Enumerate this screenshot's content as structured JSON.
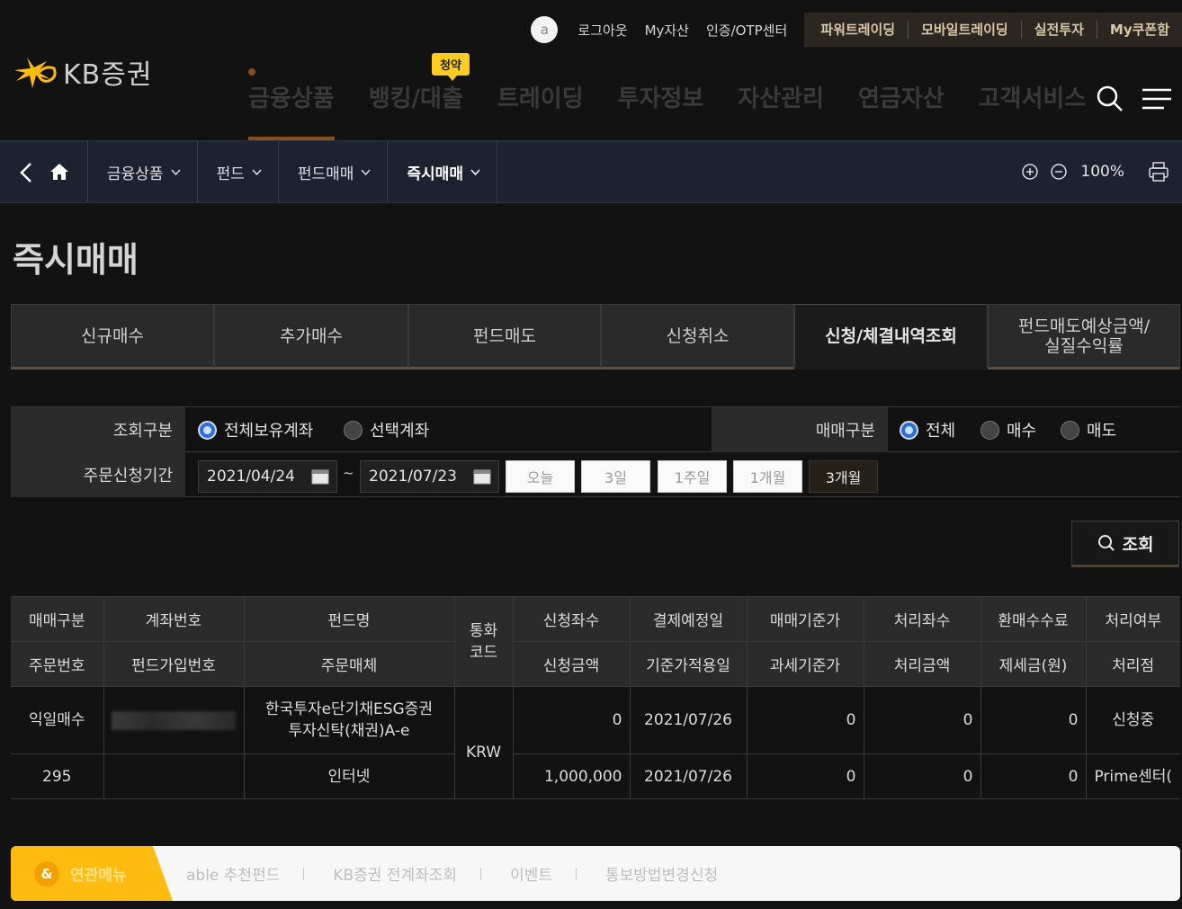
{
  "header": {
    "avatar_letter": "a",
    "util_links": [
      "로그아웃",
      "My자산",
      "인증/OTP센터"
    ],
    "util_box": [
      "파워트레이딩",
      "모바일트레이딩",
      "실전투자",
      "My쿠폰함"
    ],
    "logo_text": "KB증권",
    "gnb": [
      "금융상품",
      "뱅킹/대출",
      "트레이딩",
      "투자정보",
      "자산관리",
      "연금자산",
      "고객서비스"
    ],
    "badge": "청약",
    "logo_color": "#ffbb10"
  },
  "breadcrumb": {
    "items": [
      "금융상품",
      "펀드",
      "펀드매매",
      "즉시매매"
    ],
    "zoom": "100%"
  },
  "page_title": "즉시매매",
  "tabs": [
    "신규매수",
    "추가매수",
    "펀드매도",
    "신청취소",
    "신청/체결내역조회",
    "펀드매도예상금액/\n실질수익률"
  ],
  "active_tab": "신청/체결내역조회",
  "form": {
    "query_type_label": "조회구분",
    "query_opt_all": "전체보유계좌",
    "query_opt_select": "선택계좌",
    "trade_type_label": "매매구분",
    "trade_opt_all": "전체",
    "trade_opt_buy": "매수",
    "trade_opt_sell": "매도",
    "period_label": "주문신청기간",
    "date_from": "2021/04/24",
    "date_to": "2021/07/23",
    "tilde": "~",
    "period_buttons": [
      "오늘",
      "3일",
      "1주일",
      "1개월",
      "3개월"
    ],
    "active_period": "3개월"
  },
  "search_button": "조회",
  "table": {
    "headers_row1": [
      "매매구분",
      "계좌번호",
      "펀드명",
      "통화\n코드",
      "신청좌수",
      "결제예정일",
      "매매기준가",
      "처리좌수",
      "환매수수료",
      "처리여부"
    ],
    "headers_row2": [
      "주문번호",
      "펀드가입번호",
      "주문매체",
      "신청금액",
      "기준가적용일",
      "과세기준가",
      "처리금액",
      "제세금(원)",
      "처리점"
    ],
    "rows": [
      {
        "trade_type": "익일매수",
        "fund_name": "한국투자e단기채ESG증권\n투자신탁(채권)A-e",
        "currency": "KRW",
        "req_units": "0",
        "settle_date": "2021/07/26",
        "base_price": "0",
        "proc_units": "0",
        "redemption_fee": "0",
        "status": "신청중",
        "order_no": "295",
        "order_media": "인터넷",
        "req_amount": "1,000,000",
        "price_apply_date": "2021/07/26",
        "tax_base_price": "0",
        "proc_amount": "0",
        "tax": "0",
        "branch": "Prime센터("
      }
    ]
  },
  "related": {
    "title": "연관메뉴",
    "icon_letter": "&",
    "links": [
      "able 추천펀드",
      "KB증권 전계좌조회",
      "이벤트",
      "통보방법변경신청"
    ]
  }
}
